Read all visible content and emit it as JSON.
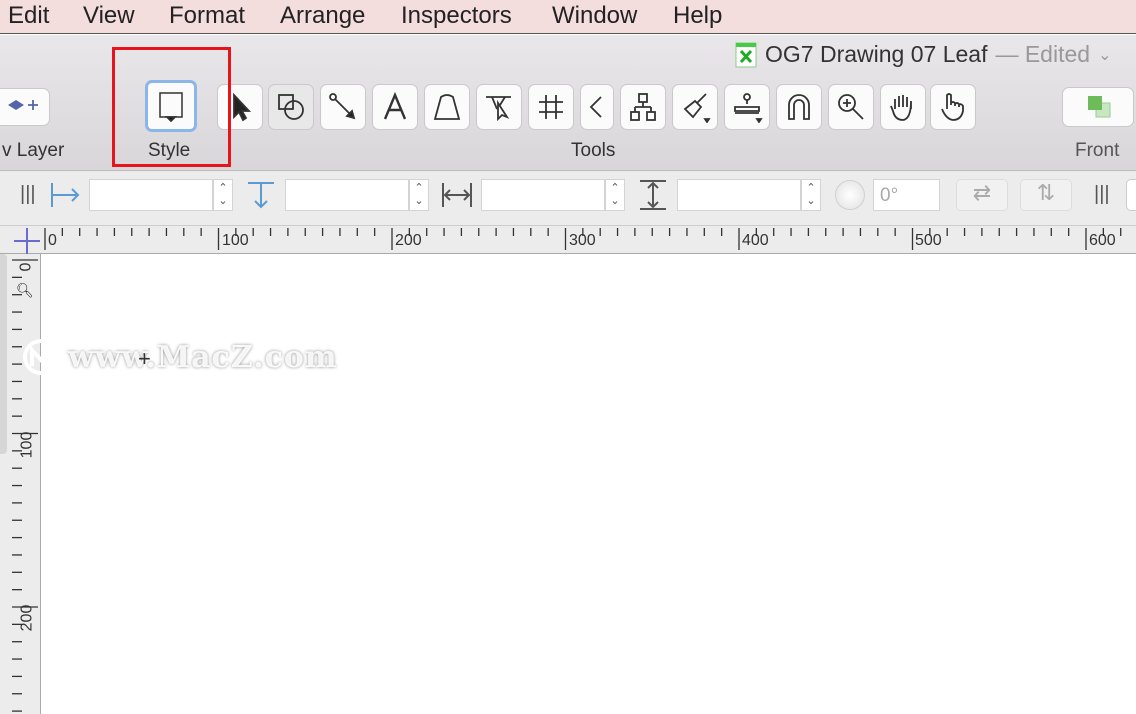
{
  "menubar": {
    "items": [
      "Edit",
      "View",
      "Format",
      "Arrange",
      "Inspectors",
      "Window",
      "Help"
    ]
  },
  "window": {
    "title": "OG7 Drawing 07 Leaf",
    "status": "— Edited"
  },
  "toolbar": {
    "new_layer_label": "v Layer",
    "style_label": "Style",
    "tools_label": "Tools",
    "front_label": "Front",
    "tools": [
      "selection-tool",
      "shape-tool",
      "line-tool",
      "text-tool",
      "pen-tool",
      "point-editor-tool",
      "grid-tool",
      "collapse-tools",
      "diagram-tool",
      "style-brush-tool",
      "rubber-stamp-tool",
      "magnet-tool",
      "zoom-tool",
      "hand-tool",
      "browse-tool"
    ]
  },
  "formatbar": {
    "x_value": "",
    "y_value": "",
    "width_value": "",
    "height_value": "",
    "rotation_value": "0°"
  },
  "rulers": {
    "horizontal": [
      "0",
      "100",
      "200",
      "300",
      "400",
      "500",
      "600"
    ],
    "vertical": [
      "0",
      "100",
      "200"
    ]
  },
  "watermark": "www.MacZ.com",
  "colors": {
    "highlight": "#e8141c",
    "menubar": "#f4dddd",
    "accent": "#5b9bd5"
  }
}
